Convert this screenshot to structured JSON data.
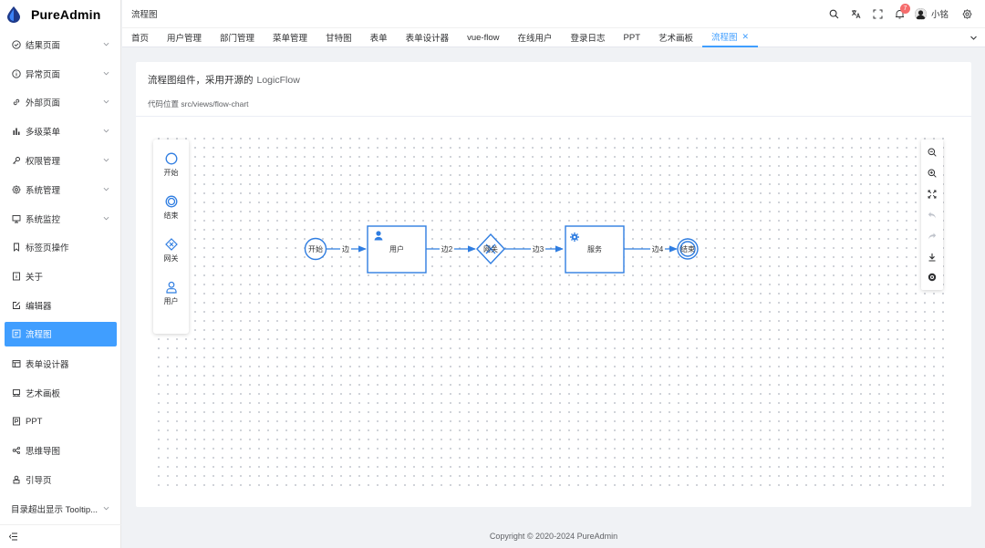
{
  "app": {
    "title": "PureAdmin",
    "brand_color": "#409eff"
  },
  "sidebar": {
    "items": [
      {
        "label": "结果页面",
        "icon": "check-circle-icon",
        "has_children": true
      },
      {
        "label": "异常页面",
        "icon": "info-circle-icon",
        "has_children": true
      },
      {
        "label": "外部页面",
        "icon": "link-icon",
        "has_children": true
      },
      {
        "label": "多级菜单",
        "icon": "bar-chart-icon",
        "has_children": true
      },
      {
        "label": "权限管理",
        "icon": "key-icon",
        "has_children": true
      },
      {
        "label": "系统管理",
        "icon": "gear-icon",
        "has_children": true
      },
      {
        "label": "系统监控",
        "icon": "monitor-icon",
        "has_children": true
      },
      {
        "label": "标签页操作",
        "icon": "bookmark-icon",
        "has_children": false
      },
      {
        "label": "关于",
        "icon": "about-icon",
        "has_children": false
      },
      {
        "label": "编辑器",
        "icon": "edit-icon",
        "has_children": false
      },
      {
        "label": "流程图",
        "icon": "flowchart-icon",
        "has_children": false,
        "active": true
      },
      {
        "label": "表单设计器",
        "icon": "form-icon",
        "has_children": false
      },
      {
        "label": "艺术画板",
        "icon": "board-icon",
        "has_children": false
      },
      {
        "label": "PPT",
        "icon": "ppt-icon",
        "has_children": false
      },
      {
        "label": "思维导图",
        "icon": "mindmap-icon",
        "has_children": false
      },
      {
        "label": "引导页",
        "icon": "guide-icon",
        "has_children": false
      },
      {
        "label": "目录超出显示 Tooltip...",
        "icon": "",
        "has_children": true
      }
    ]
  },
  "header": {
    "breadcrumb": "流程图",
    "notification_count": "7",
    "username": "小铭"
  },
  "tabs": [
    "首页",
    "用户管理",
    "部门管理",
    "菜单管理",
    "甘特图",
    "表单",
    "表单设计器",
    "vue-flow",
    "在线用户",
    "登录日志",
    "PPT",
    "艺术画板",
    "流程图"
  ],
  "active_tab": "流程图",
  "card": {
    "title": "流程图组件，采用开源的",
    "title_link": "LogicFlow",
    "subtitle": "代码位置 src/views/flow-chart"
  },
  "palette": {
    "items": [
      {
        "label": "开始",
        "icon": "circle-icon"
      },
      {
        "label": "结束",
        "icon": "double-circle-icon"
      },
      {
        "label": "网关",
        "icon": "diamond-icon"
      },
      {
        "label": "用户",
        "icon": "user-icon"
      }
    ]
  },
  "controls": [
    "zoom-out-icon",
    "zoom-in-icon",
    "fit-view-icon",
    "undo-icon",
    "redo-icon",
    "download-icon",
    "minimap-icon"
  ],
  "flow": {
    "nodes": {
      "start": "开始",
      "user": "用户",
      "gateway": "网关",
      "service": "服务",
      "end": "结束"
    },
    "edges": {
      "e1": "边",
      "e2": "边2",
      "e3": "边3",
      "e4": "边4"
    }
  },
  "footer": "Copyright © 2020-2024 PureAdmin"
}
